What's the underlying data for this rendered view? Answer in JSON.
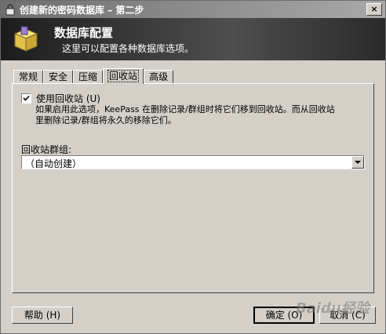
{
  "window": {
    "title": "创建新的密码数据库 – 第二步",
    "close_label": "×"
  },
  "banner": {
    "title": "数据库配置",
    "subtitle": "这里可以配置各种数据库选项。"
  },
  "tabs": [
    {
      "label": "常规"
    },
    {
      "label": "安全"
    },
    {
      "label": "压缩"
    },
    {
      "label": "回收站",
      "active": true
    },
    {
      "label": "高级"
    }
  ],
  "recycle": {
    "checkbox_label": "使用回收站 (U)",
    "checked": true,
    "description_line1": "如果启用此选项，KeePass 在删除记录/群组时将它们移到回收站。而从回收站",
    "description_line2": "里删除记录/群组将永久的移除它们。",
    "group_label": "回收站群组:",
    "group_value": "（自动创建）"
  },
  "buttons": {
    "help": "帮助 (H)",
    "ok": "确定 (O)",
    "cancel": "取消 (C)"
  },
  "watermark": "Baidu经验",
  "icons": {
    "title": "lock-icon",
    "banner": "database-icon",
    "dropdown": "chevron-down-icon"
  },
  "colors": {
    "banner_bg": "#2a2a2a",
    "face": "#d4d0c8"
  }
}
